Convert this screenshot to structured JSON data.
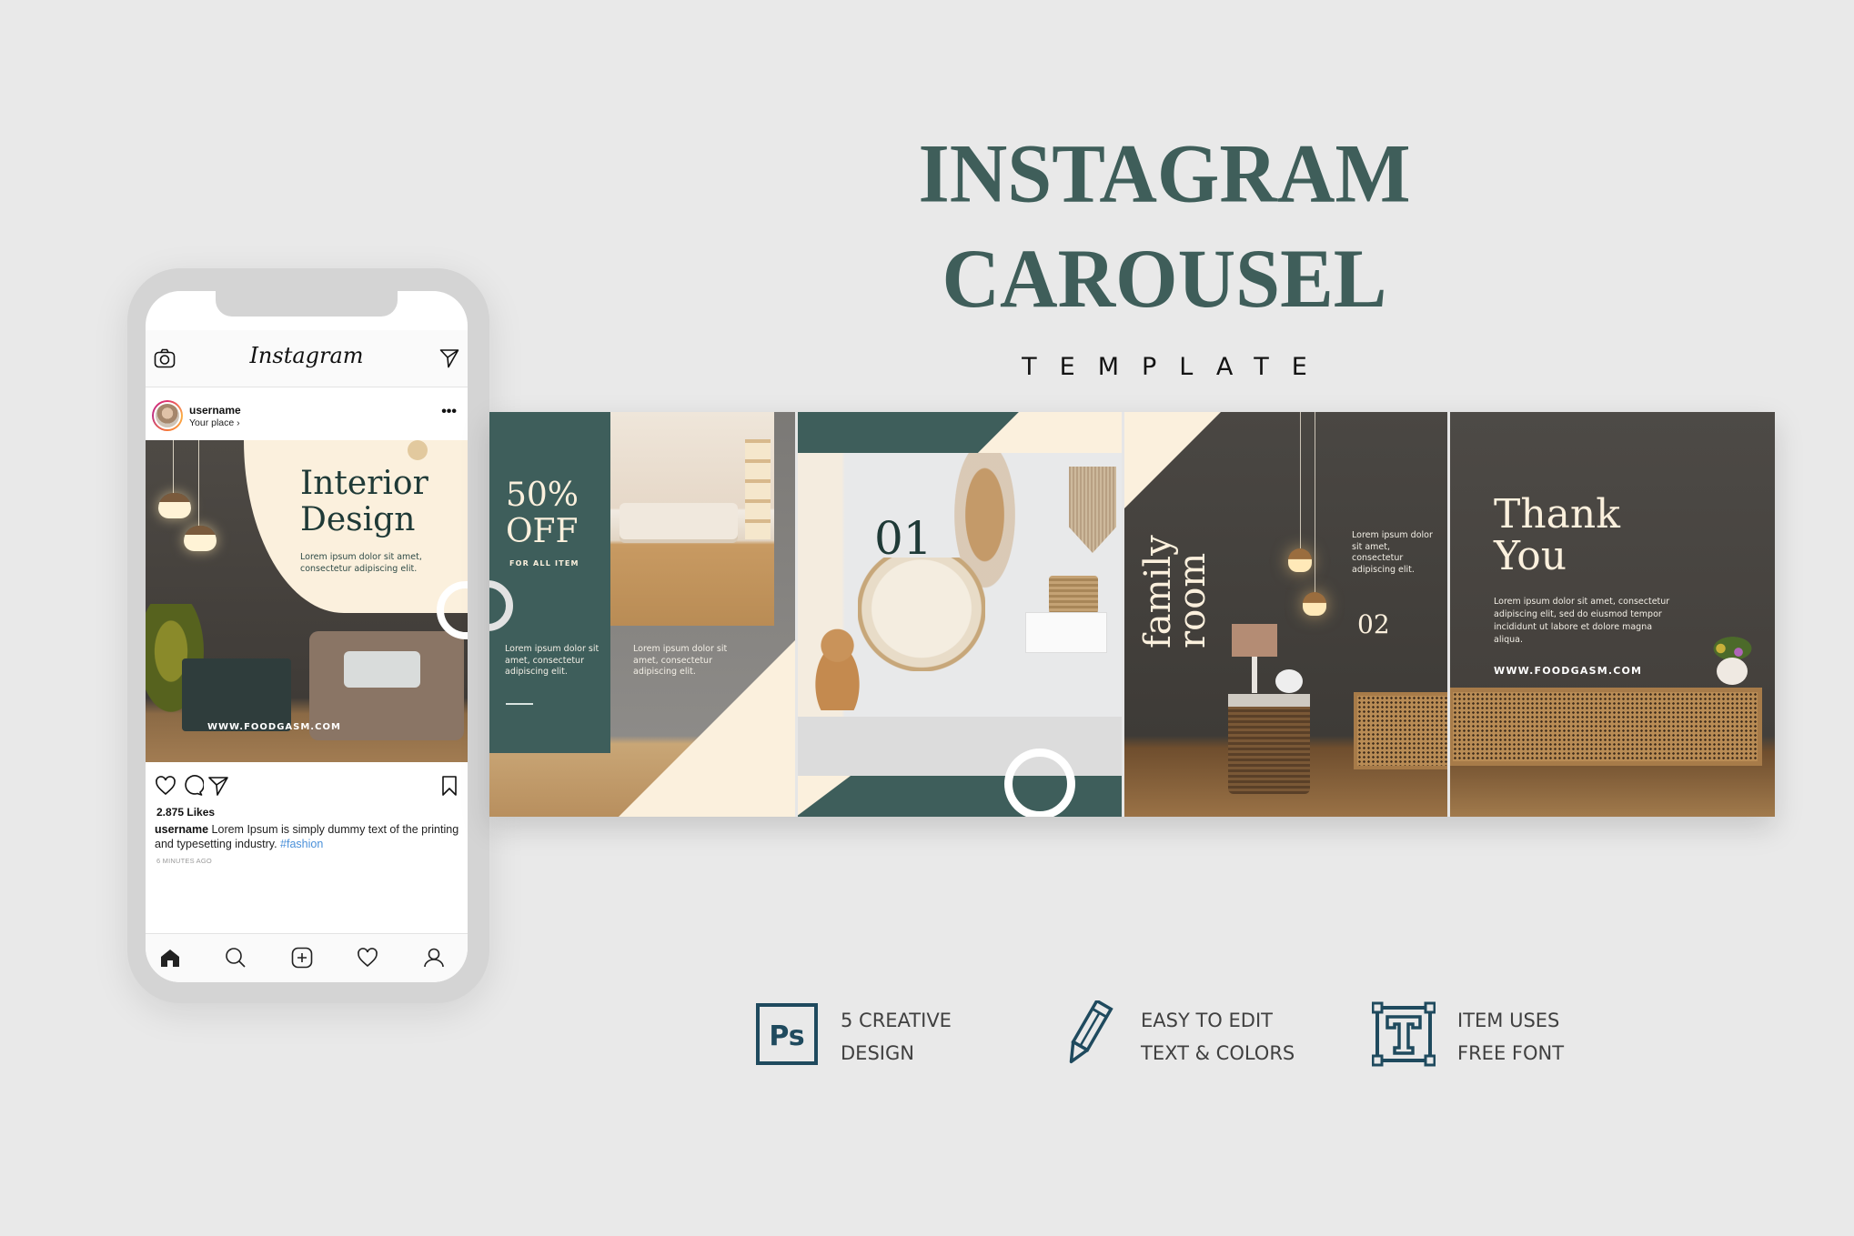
{
  "headline": {
    "title": "INSTAGRAM CAROUSEL",
    "subtitle": "TEMPLATE",
    "title_color": "#3f5e5a"
  },
  "phone": {
    "app_name": "Instagram",
    "icons": {
      "left": "camera-icon",
      "right": "direct-send-icon"
    },
    "post": {
      "username": "username",
      "location": "Your place ›",
      "more": "•••",
      "image": {
        "title_line1": "Interior",
        "title_line2": "Design",
        "body": "Lorem ipsum dolor sit amet, consectetur adipiscing elit.",
        "url": "WWW.FOODGASM.COM"
      },
      "actions": [
        "heart-icon",
        "comment-icon",
        "share-icon",
        "bookmark-icon"
      ],
      "likes": "2.875 Likes",
      "caption_user": "username",
      "caption_text": " Lorem Ipsum is simply dummy text of the printing and typesetting industry. ",
      "hashtag": "#fashion",
      "time_ago": "6 MINUTES AGO"
    },
    "tabbar": [
      "home-icon",
      "search-icon",
      "add-post-icon",
      "activity-heart-icon",
      "profile-icon"
    ]
  },
  "carousel": {
    "colors": {
      "green": "#3e5e5b",
      "cream": "#fbf0dd",
      "dark": "#3f3c38"
    },
    "slides": [
      {
        "headline_line1": "50%",
        "headline_line2": "OFF",
        "subhead": "FOR ALL ITEM",
        "body_left": "Lorem ipsum dolor sit amet, consectetur adipiscing elit.",
        "body_right": "Lorem ipsum dolor sit amet, consectetur adipiscing elit."
      },
      {
        "number": "01"
      },
      {
        "vertical_title": "family\nroom",
        "body": "Lorem ipsum dolor sit amet, consectetur adipiscing elit.",
        "number": "02"
      },
      {
        "headline_line1": "Thank",
        "headline_line2": "You",
        "body": "Lorem ipsum dolor sit amet, consectetur adipiscing elit, sed do eiusmod tempor incididunt ut labore et dolore magna aliqua.",
        "url": "WWW.FOODGASM.COM"
      }
    ]
  },
  "features": [
    {
      "icon": "photoshop-icon",
      "icon_text": "Ps",
      "line1": "5 CREATIVE",
      "line2": "DESIGN"
    },
    {
      "icon": "pencil-icon",
      "line1": "EASY TO EDIT",
      "line2": "TEXT & COLORS"
    },
    {
      "icon": "font-icon",
      "line1": "ITEM USES",
      "line2": "FREE FONT"
    }
  ],
  "feature_icon_color": "#1f4a5e"
}
